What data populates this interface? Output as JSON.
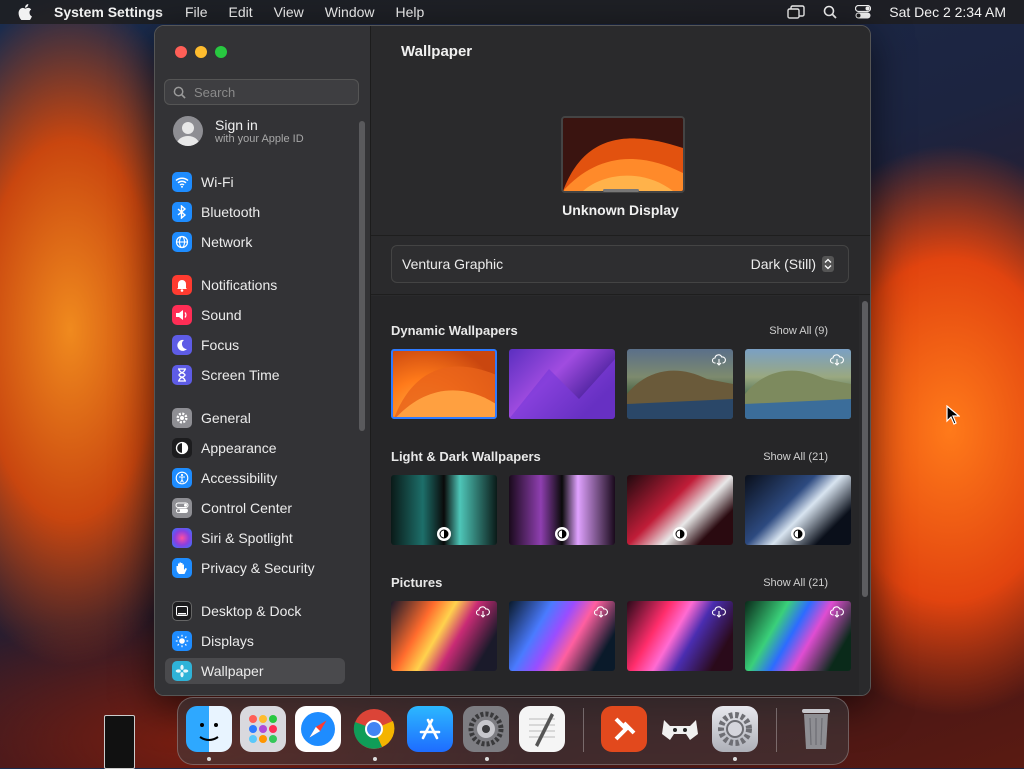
{
  "menubar": {
    "app_name": "System Settings",
    "menus": [
      "File",
      "Edit",
      "View",
      "Window",
      "Help"
    ],
    "clock": "Sat Dec 2  2:34 AM"
  },
  "sidebar": {
    "search_placeholder": "Search",
    "account": {
      "title": "Sign in",
      "subtitle": "with your Apple ID"
    },
    "items": [
      {
        "label": "Wi-Fi",
        "color": "#1e8cff",
        "icon": "wifi-icon"
      },
      {
        "label": "Bluetooth",
        "color": "#1e8cff",
        "icon": "bluetooth-icon"
      },
      {
        "label": "Network",
        "color": "#1e8cff",
        "icon": "globe-icon"
      },
      {
        "label": "Notifications",
        "color": "#ff3b30",
        "icon": "bell-icon"
      },
      {
        "label": "Sound",
        "color": "#ff2d55",
        "icon": "speaker-icon"
      },
      {
        "label": "Focus",
        "color": "#5e5ce6",
        "icon": "moon-icon"
      },
      {
        "label": "Screen Time",
        "color": "#5e5ce6",
        "icon": "hourglass-icon"
      },
      {
        "label": "General",
        "color": "#8e8e93",
        "icon": "gear-icon"
      },
      {
        "label": "Appearance",
        "color": "#1c1c1e",
        "icon": "appearance-icon"
      },
      {
        "label": "Accessibility",
        "color": "#1e8cff",
        "icon": "accessibility-icon"
      },
      {
        "label": "Control Center",
        "color": "#8e8e93",
        "icon": "toggles-icon"
      },
      {
        "label": "Siri & Spotlight",
        "color": "#b04bd8",
        "icon": "siri-icon"
      },
      {
        "label": "Privacy & Security",
        "color": "#1e8cff",
        "icon": "hand-icon"
      },
      {
        "label": "Desktop & Dock",
        "color": "#1c1c1e",
        "icon": "dock-icon"
      },
      {
        "label": "Displays",
        "color": "#1e8cff",
        "icon": "sun-icon"
      },
      {
        "label": "Wallpaper",
        "color": "#2fb3d8",
        "icon": "flower-icon"
      }
    ],
    "selected": "Wallpaper"
  },
  "main": {
    "title": "Wallpaper",
    "display_name": "Unknown Display",
    "wallpaper_name": "Ventura Graphic",
    "wallpaper_mode": "Dark (Still)",
    "sections": [
      {
        "title": "Dynamic Wallpapers",
        "show_all": "Show All (9)"
      },
      {
        "title": "Light & Dark Wallpapers",
        "show_all": "Show All (21)"
      },
      {
        "title": "Pictures",
        "show_all": "Show All (21)"
      }
    ]
  },
  "dock": {
    "apps": [
      "Finder",
      "Launchpad",
      "Safari",
      "Chrome",
      "App Store",
      "System Preferences",
      "TextEdit",
      "Microsoft Remote Desktop",
      "Retroarch",
      "System Settings",
      "Trash"
    ]
  }
}
